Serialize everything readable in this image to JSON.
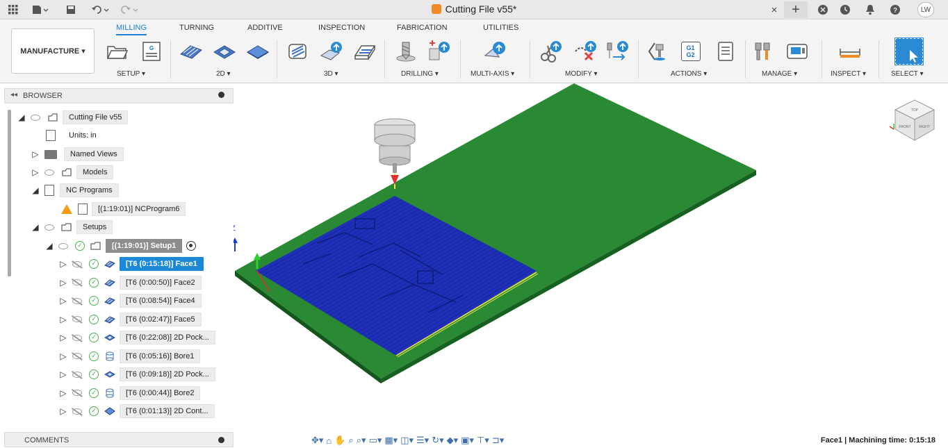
{
  "window": {
    "title": "Cutting File v55*",
    "user_initials": "LW",
    "close_glyph": "×",
    "new_tab_glyph": "+"
  },
  "ribbon": {
    "workspace": "MANUFACTURE ▾",
    "tabs": [
      "MILLING",
      "TURNING",
      "ADDITIVE",
      "INSPECTION",
      "FABRICATION",
      "UTILITIES"
    ],
    "active_tab": "MILLING",
    "groups": [
      "SETUP ▾",
      "2D ▾",
      "3D ▾",
      "DRILLING ▾",
      "MULTI-AXIS ▾",
      "MODIFY ▾",
      "ACTIONS ▾",
      "MANAGE ▾",
      "INSPECT ▾",
      "SELECT ▾"
    ],
    "g1g2_label": "G1\nG2"
  },
  "browser": {
    "title": "BROWSER",
    "collapse_glyph": "◂◂",
    "root": "Cutting File v55",
    "units": "Units: in",
    "named_views": "Named Views",
    "models": "Models",
    "nc_programs": "NC Programs",
    "nc_program": "[(1:19:01)] NCProgram6",
    "setups": "Setups",
    "setup": "[(1:19:01)] Setup1",
    "operations": [
      "[T6 (0:15:18)] Face1",
      "[T6 (0:00:50)] Face2",
      "[T6 (0:08:54)] Face4",
      "[T6 (0:02:47)] Face5",
      "[T6 (0:22:08)] 2D Pock...",
      "[T6 (0:05:16)] Bore1",
      "[T6 (0:09:18)] 2D Pock...",
      "[T6 (0:00:44)] Bore2",
      "[T6 (0:01:13)] 2D Cont..."
    ]
  },
  "comments": {
    "title": "COMMENTS"
  },
  "viewport": {
    "axis_z": "Z",
    "board_color": "#1e7a2a",
    "pocket_color": "#1f2fb8",
    "tool_color": "#d8d8d8",
    "viewcube_labels": [
      "TOP",
      "FRONT",
      "RIGHT"
    ]
  },
  "status": {
    "text": "Face1 | Machining time: 0:15:18"
  }
}
